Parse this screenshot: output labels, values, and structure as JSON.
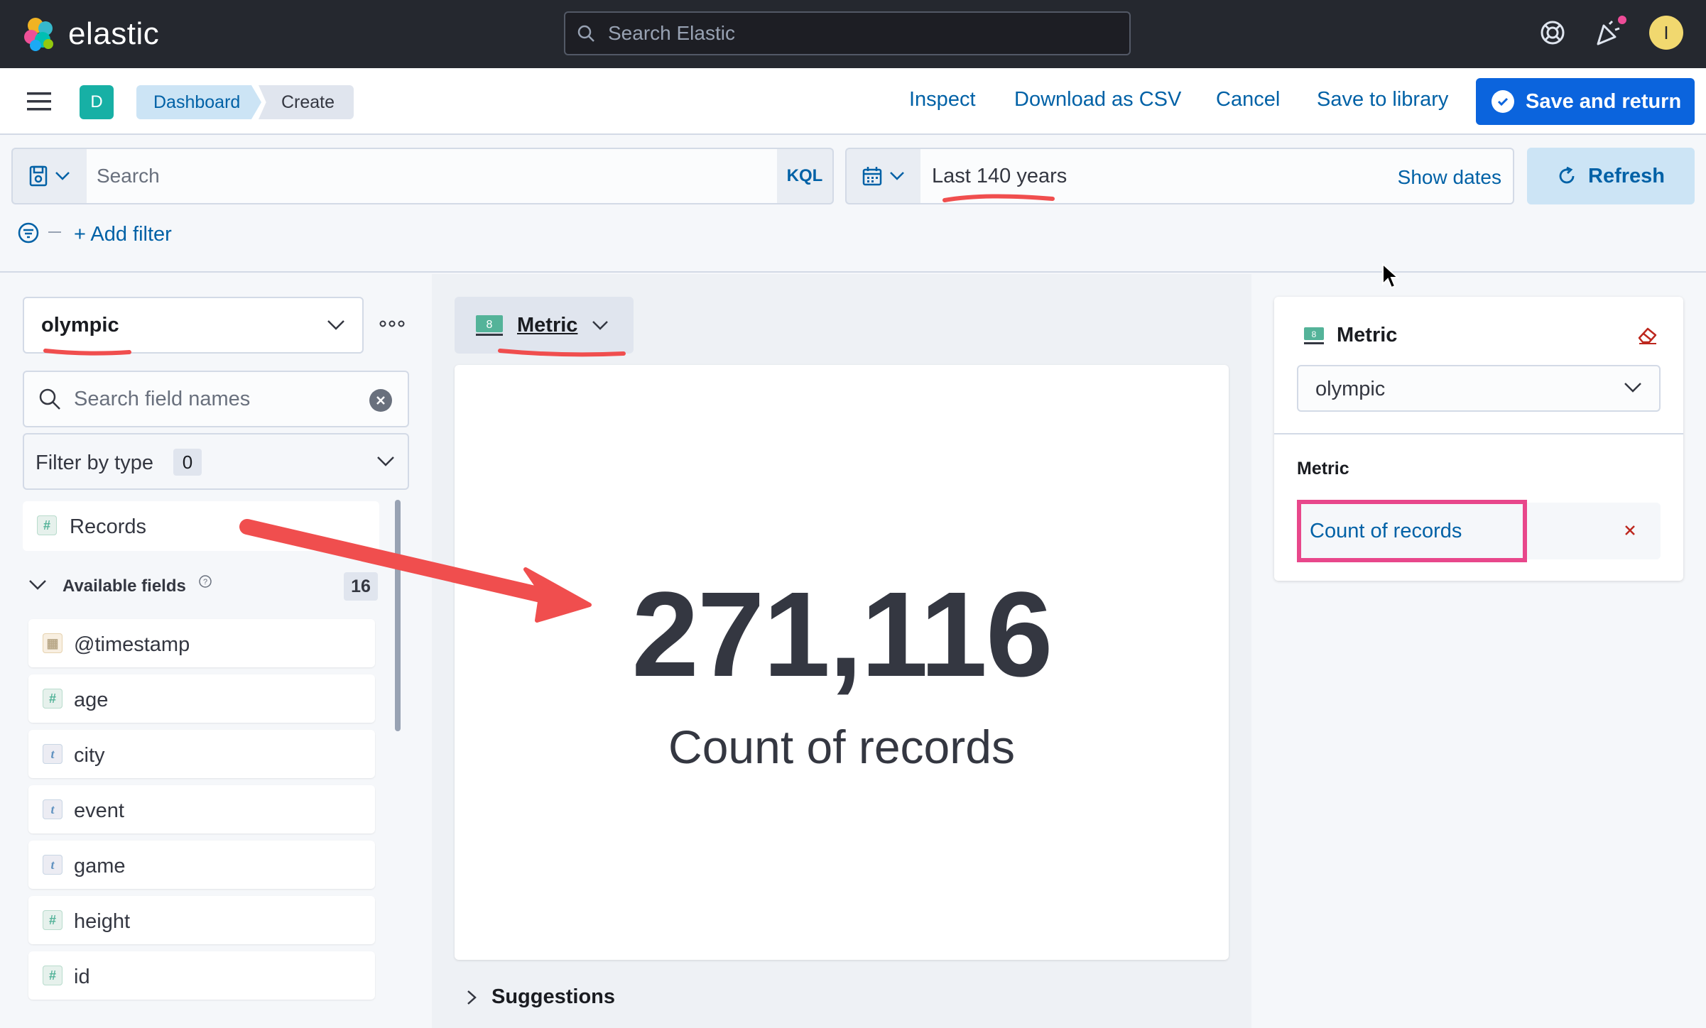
{
  "header": {
    "logo_text": "elastic",
    "search_placeholder": "Search Elastic",
    "avatar_initial": "I"
  },
  "subbar": {
    "space_initial": "D",
    "breadcrumbs": [
      "Dashboard",
      "Create"
    ],
    "actions": {
      "inspect": "Inspect",
      "download_csv": "Download as CSV",
      "cancel": "Cancel",
      "save_to_library": "Save to library",
      "save_and_return": "Save and return"
    }
  },
  "query_bar": {
    "search_placeholder": "Search",
    "language": "KQL",
    "date_range": "Last 140 years",
    "show_dates": "Show dates",
    "refresh": "Refresh",
    "add_filter": "+ Add filter"
  },
  "left_panel": {
    "index_pattern": "olympic",
    "field_search_placeholder": "Search field names",
    "filter_by_type_label": "Filter by type",
    "filter_by_type_count": "0",
    "records_label": "Records",
    "available_fields_label": "Available fields",
    "available_fields_count": "16",
    "fields": [
      {
        "name": "@timestamp",
        "type": "date",
        "token": "▦"
      },
      {
        "name": "age",
        "type": "number",
        "token": "#"
      },
      {
        "name": "city",
        "type": "string",
        "token": "t"
      },
      {
        "name": "event",
        "type": "string",
        "token": "t"
      },
      {
        "name": "game",
        "type": "string",
        "token": "t"
      },
      {
        "name": "height",
        "type": "number",
        "token": "#"
      },
      {
        "name": "id",
        "type": "number",
        "token": "#"
      }
    ]
  },
  "workspace": {
    "chart_type": "Metric",
    "metric_value": "271,116",
    "metric_label": "Count of records",
    "suggestions_label": "Suggestions"
  },
  "config_panel": {
    "title": "Metric",
    "layer_index": "olympic",
    "section_label": "Metric",
    "dimension_label": "Count of records"
  },
  "colors": {
    "header_bg": "#25282f",
    "primary": "#0b64dd",
    "link": "#0061a6",
    "annotation_red": "#f04e4e",
    "annotation_pink": "#e8478b"
  }
}
